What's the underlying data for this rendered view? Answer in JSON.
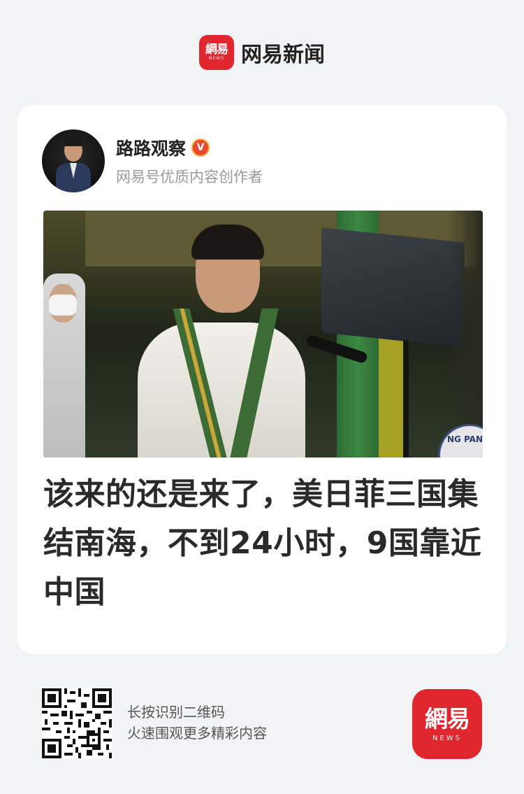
{
  "header": {
    "logo_cn": "網易",
    "logo_en": "NEWS",
    "app_name": "网易新闻"
  },
  "article": {
    "author_name": "路路观察",
    "verified_mark": "V",
    "author_subtitle": "网易号优质内容创作者",
    "photo_seal_text": "NG PANGU",
    "headline": "该来的还是来了，美日菲三国集结南海，不到24小时，9国靠近中国"
  },
  "footer": {
    "qr_line1": "长按识别二维码",
    "qr_line2": "火速围观更多精彩内容",
    "app_logo_cn": "網易",
    "app_logo_en": "NEWS"
  },
  "colors": {
    "brand_red": "#e0262e",
    "background": "#f2f3f5",
    "card": "#ffffff"
  }
}
